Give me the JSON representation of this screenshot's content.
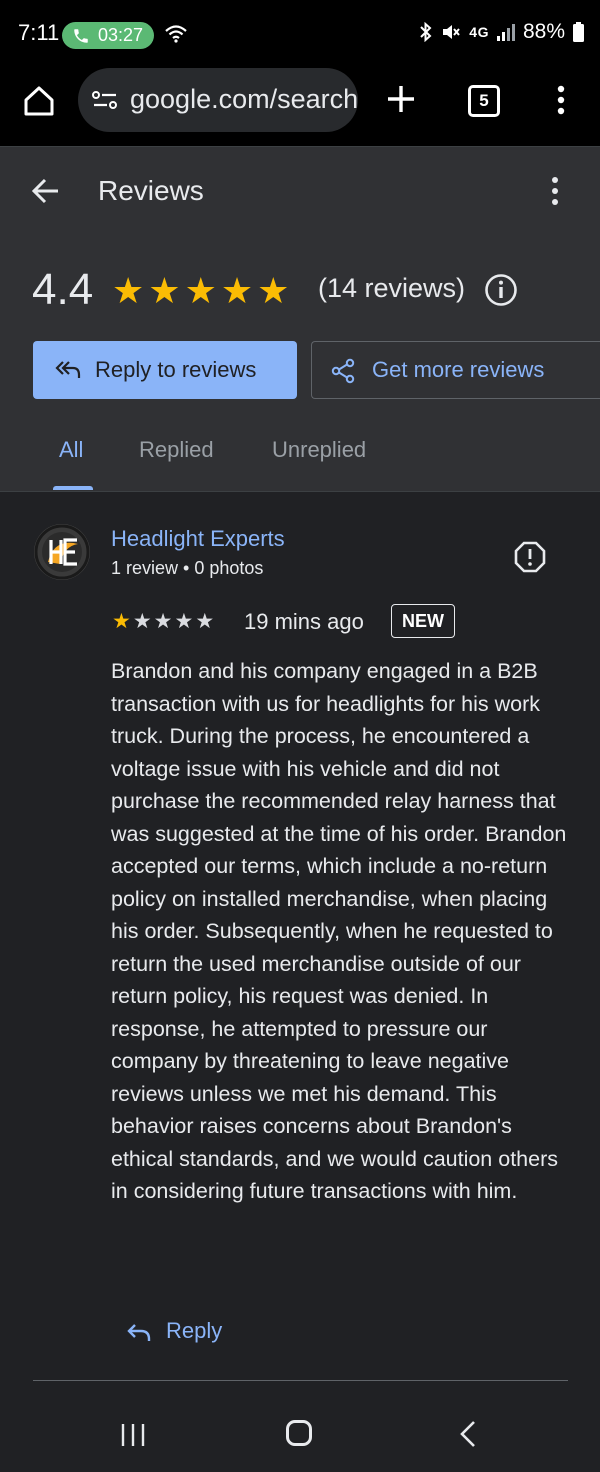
{
  "status_bar": {
    "time": "7:11",
    "call_timer": "03:27",
    "network": "4G",
    "battery": "88%"
  },
  "browser": {
    "url": "google.com/search",
    "tab_count": "5"
  },
  "header": {
    "title": "Reviews",
    "rating": "4.4",
    "stars_filled": 5,
    "review_count": "(14 reviews)",
    "reply_button": "Reply to reviews",
    "get_more_button": "Get more reviews",
    "tabs": [
      {
        "label": "All",
        "active": true
      },
      {
        "label": "Replied",
        "active": false
      },
      {
        "label": "Unreplied",
        "active": false
      }
    ]
  },
  "review": {
    "reviewer": "Headlight Experts",
    "reviewer_meta": "1 review • 0 photos",
    "stars": 1,
    "time": "19 mins ago",
    "badge": "NEW",
    "text": "Brandon and his company engaged in a B2B transaction with us for headlights for his work truck. During the process, he encountered a voltage issue with his vehicle and did not purchase the recommended relay harness that was suggested at the time of his order. Brandon accepted our terms, which include a no-return policy on installed merchandise, when placing his order. Subsequently, when he requested to return the used merchandise outside of our return policy, his request was denied. In response, he attempted to pressure our company by threatening to leave negative reviews unless we met his demand. This behavior raises concerns about Brandon's ethical standards, and we would caution others in considering future transactions with him.",
    "reply_label": "Reply"
  },
  "colors": {
    "accent": "#8ab4f8",
    "star": "#fbbc04",
    "call_pill": "#5bb974"
  }
}
